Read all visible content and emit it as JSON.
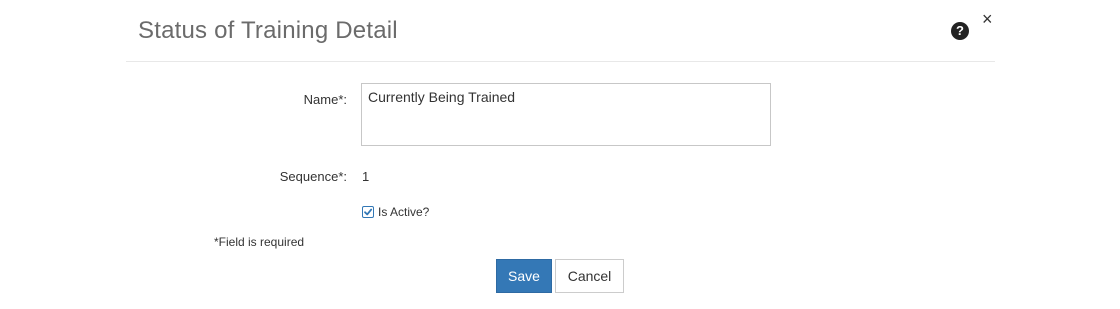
{
  "modal": {
    "title": "Status of Training Detail",
    "help_icon": "question-circle-icon",
    "close_icon": "close-icon",
    "close_glyph": "×",
    "help_glyph": "?"
  },
  "form": {
    "name_label": "Name*:",
    "name_value": "Currently Being Trained",
    "sequence_label": "Sequence*:",
    "sequence_value": "1",
    "is_active_label": "Is Active?",
    "is_active_checked": true,
    "required_note": "*Field is required"
  },
  "buttons": {
    "save_label": "Save",
    "cancel_label": "Cancel"
  },
  "colors": {
    "primary": "#3478b6",
    "title": "#6b6b6b",
    "border": "#c7c7c7"
  }
}
